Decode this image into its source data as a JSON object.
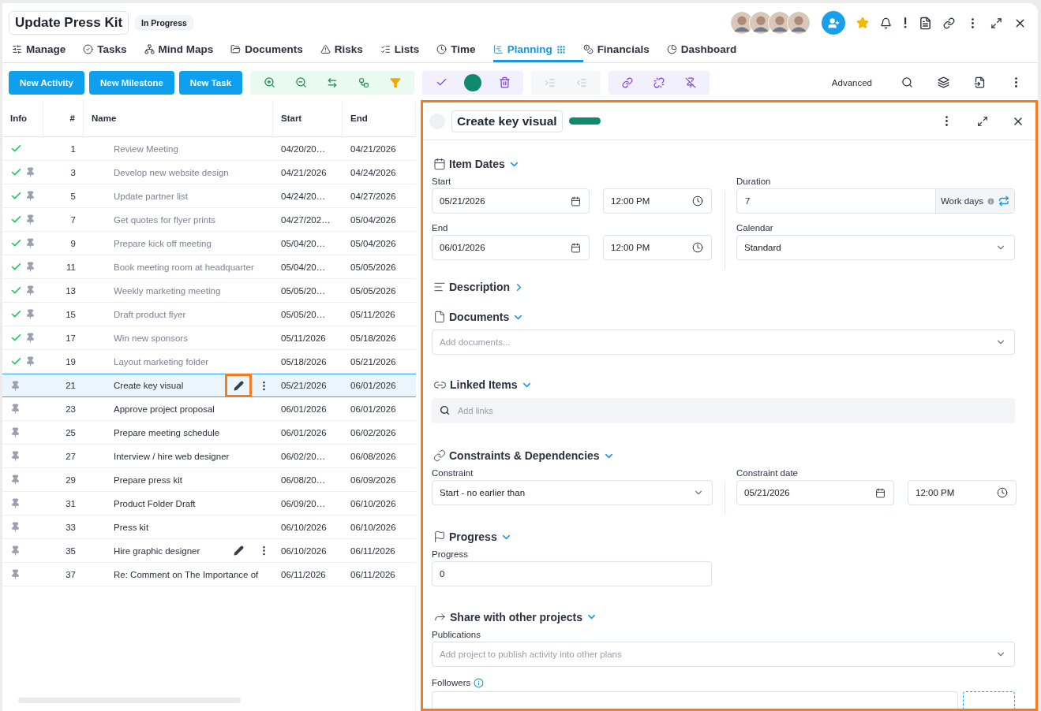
{
  "header": {
    "title": "Update Press Kit",
    "status": "In Progress"
  },
  "tabs": [
    {
      "label": "Manage",
      "selected": false
    },
    {
      "label": "Tasks",
      "selected": false
    },
    {
      "label": "Mind Maps",
      "selected": false
    },
    {
      "label": "Documents",
      "selected": false
    },
    {
      "label": "Risks",
      "selected": false
    },
    {
      "label": "Lists",
      "selected": false
    },
    {
      "label": "Time",
      "selected": false
    },
    {
      "label": "Planning",
      "selected": true
    },
    {
      "label": "Financials",
      "selected": false
    },
    {
      "label": "Dashboard",
      "selected": false
    }
  ],
  "toolbar": {
    "buttons": [
      "New Activity",
      "New Milestone",
      "New Task"
    ],
    "advanced": "Advanced"
  },
  "table": {
    "columns": [
      "Info",
      "#",
      "Name",
      "Start",
      "End"
    ],
    "rows": [
      {
        "done": true,
        "pinned": false,
        "number": "1",
        "name": "Review Meeting",
        "start": "04/20/20…",
        "end": "04/21/2026",
        "selected": false,
        "actions": false
      },
      {
        "done": true,
        "pinned": true,
        "number": "3",
        "name": "Develop new website design",
        "start": "04/21/2026",
        "end": "04/24/2026",
        "selected": false,
        "actions": false
      },
      {
        "done": true,
        "pinned": true,
        "number": "5",
        "name": "Update partner list",
        "start": "04/24/20…",
        "end": "04/27/2026",
        "selected": false,
        "actions": false
      },
      {
        "done": true,
        "pinned": true,
        "number": "7",
        "name": "Get quotes for flyer prints",
        "start": "04/27/202…",
        "end": "05/04/2026",
        "selected": false,
        "actions": false
      },
      {
        "done": true,
        "pinned": true,
        "number": "9",
        "name": "Prepare kick off meeting",
        "start": "05/04/20…",
        "end": "05/04/2026",
        "selected": false,
        "actions": false
      },
      {
        "done": true,
        "pinned": true,
        "number": "11",
        "name": "Book meeting room at headquarter",
        "start": "05/04/20…",
        "end": "05/05/2026",
        "selected": false,
        "actions": false
      },
      {
        "done": true,
        "pinned": true,
        "number": "13",
        "name": "Weekly marketing meeting",
        "start": "05/05/20…",
        "end": "05/05/2026",
        "selected": false,
        "actions": false
      },
      {
        "done": true,
        "pinned": true,
        "number": "15",
        "name": "Draft product flyer",
        "start": "05/05/20…",
        "end": "05/11/2026",
        "selected": false,
        "actions": false
      },
      {
        "done": true,
        "pinned": true,
        "number": "17",
        "name": "Win new sponsors",
        "start": "05/11/2026",
        "end": "05/18/2026",
        "selected": false,
        "actions": false
      },
      {
        "done": true,
        "pinned": true,
        "number": "19",
        "name": "Layout marketing folder",
        "start": "05/18/2026",
        "end": "05/21/2026",
        "selected": false,
        "actions": false
      },
      {
        "done": false,
        "pinned": true,
        "number": "21",
        "name": "Create key visual",
        "start": "05/21/2026",
        "end": "06/01/2026",
        "selected": true,
        "actions": true,
        "highlighted": true
      },
      {
        "done": false,
        "pinned": true,
        "number": "23",
        "name": "Approve project proposal",
        "start": "06/01/2026",
        "end": "06/01/2026",
        "selected": false,
        "actions": false
      },
      {
        "done": false,
        "pinned": true,
        "number": "25",
        "name": "Prepare meeting schedule",
        "start": "06/01/2026",
        "end": "06/02/2026",
        "selected": false,
        "actions": false
      },
      {
        "done": false,
        "pinned": true,
        "number": "27",
        "name": "Interview / hire web designer",
        "start": "06/02/20…",
        "end": "06/08/2026",
        "selected": false,
        "actions": false
      },
      {
        "done": false,
        "pinned": true,
        "number": "29",
        "name": "Prepare press kit",
        "start": "06/08/20…",
        "end": "06/09/2026",
        "selected": false,
        "actions": false
      },
      {
        "done": false,
        "pinned": true,
        "number": "31",
        "name": "Product Folder Draft",
        "start": "06/09/20…",
        "end": "06/10/2026",
        "selected": false,
        "actions": false
      },
      {
        "done": false,
        "pinned": true,
        "number": "33",
        "name": "Press kit",
        "start": "06/10/2026",
        "end": "06/10/2026",
        "selected": false,
        "actions": false
      },
      {
        "done": false,
        "pinned": true,
        "number": "35",
        "name": "Hire graphic designer",
        "start": "06/10/2026",
        "end": "06/11/2026",
        "selected": false,
        "actions": true,
        "highlighted": false
      },
      {
        "done": false,
        "pinned": true,
        "number": "37",
        "name": "Re: Comment on The Importance of",
        "start": "06/11/2026",
        "end": "06/11/2026",
        "selected": false,
        "actions": false
      }
    ]
  },
  "detail": {
    "title": "Create key visual",
    "highlighted": true,
    "item_dates": {
      "heading": "Item Dates",
      "expanded": true,
      "start_label": "Start",
      "start_date": "05/21/2026",
      "start_time": "12:00 PM",
      "end_label": "End",
      "end_date": "06/01/2026",
      "end_time": "12:00 PM",
      "duration_label": "Duration",
      "duration": "7",
      "duration_unit": "Work days",
      "calendar_label": "Calendar",
      "calendar": "Standard"
    },
    "description": {
      "heading": "Description",
      "expanded": false
    },
    "documents": {
      "heading": "Documents",
      "expanded": true,
      "placeholder": "Add documents..."
    },
    "linked_items": {
      "heading": "Linked Items",
      "expanded": true,
      "placeholder": "Add links"
    },
    "constraints": {
      "heading": "Constraints & Dependencies",
      "expanded": true,
      "constraint_label": "Constraint",
      "constraint": "Start - no earlier than",
      "date_label": "Constraint date",
      "date": "05/21/2026",
      "time": "12:00 PM"
    },
    "progress": {
      "heading": "Progress",
      "expanded": true,
      "label": "Progress",
      "value": "0"
    },
    "share": {
      "heading": "Share with other projects",
      "expanded": true,
      "label": "Publications",
      "placeholder": "Add project to publish activity into other plans"
    },
    "followers": {
      "label": "Followers"
    }
  }
}
